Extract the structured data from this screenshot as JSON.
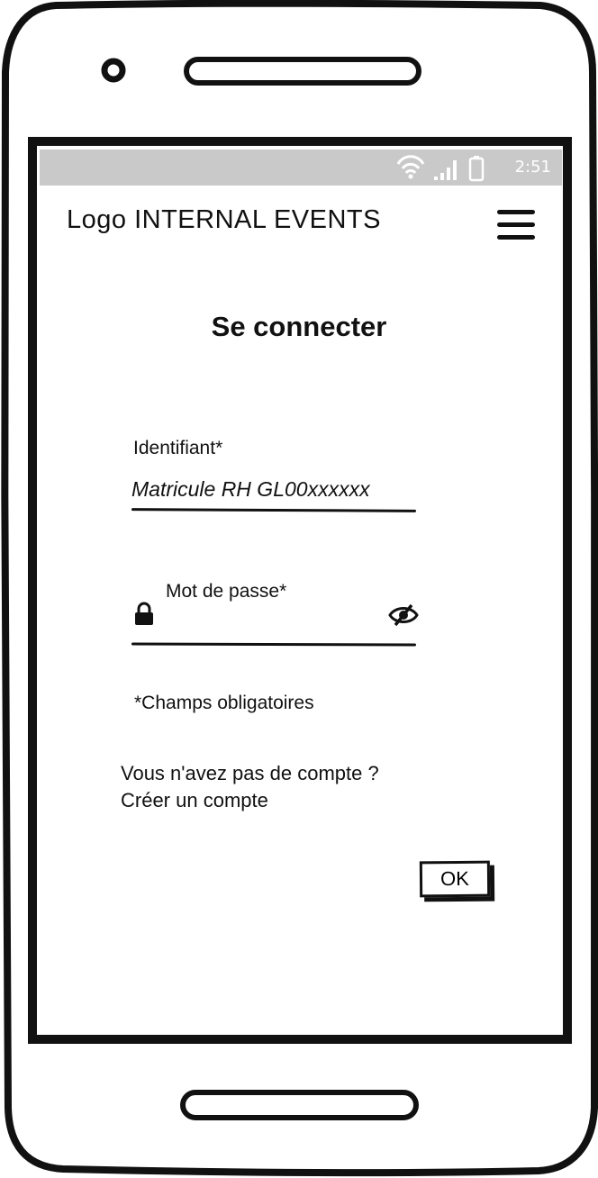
{
  "status_bar": {
    "time": "2:51",
    "icons": [
      "wifi-icon",
      "signal-icon",
      "battery-icon"
    ]
  },
  "header": {
    "title": "Logo INTERNAL EVENTS",
    "menu_icon": "hamburger-menu-icon"
  },
  "login": {
    "title": "Se connecter",
    "identifier_label": "Identifiant*",
    "identifier_placeholder": "Matricule RH GL00xxxxxx",
    "identifier_value": "",
    "password_label": "Mot de passe*",
    "password_value": "",
    "lock_icon": "lock-icon",
    "visibility_icon": "eye-slash-icon",
    "required_note": "*Champs obligatoires",
    "no_account_text": "Vous n'avez pas de compte ?",
    "create_account_link": "Créer un compte",
    "submit_label": "OK"
  },
  "colors": {
    "status_bar": "#c9c9c9",
    "ink": "#111111",
    "background": "#ffffff"
  }
}
